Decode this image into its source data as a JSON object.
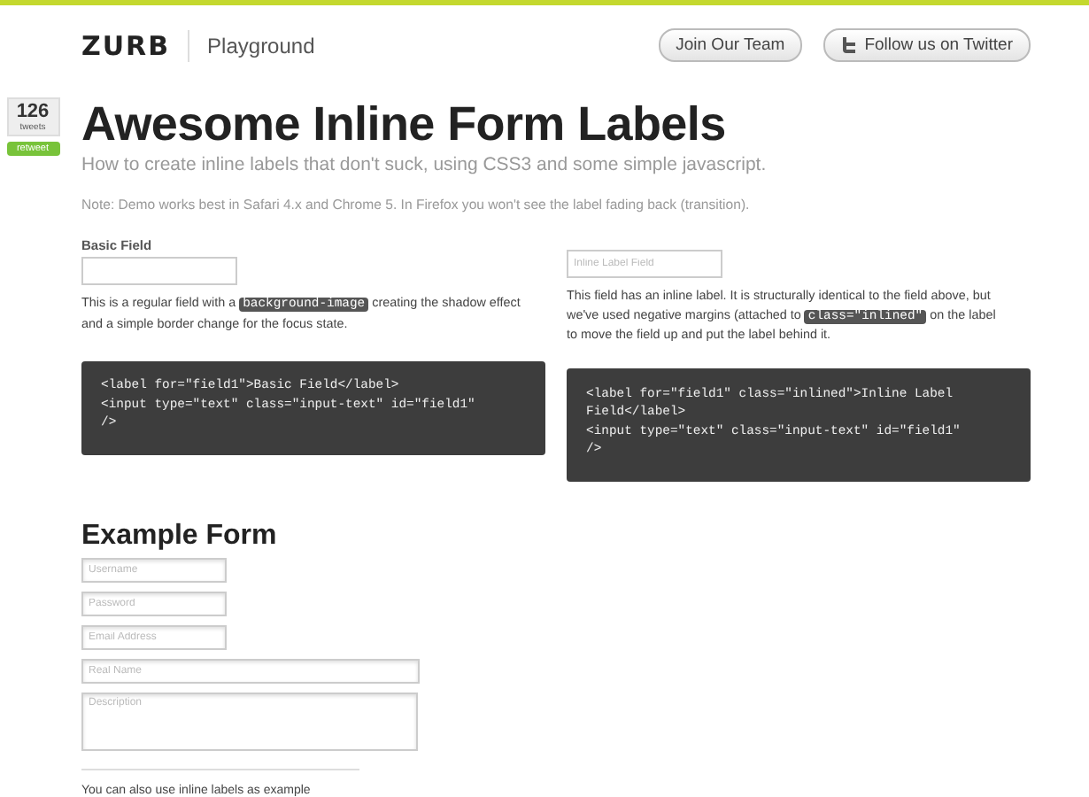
{
  "header": {
    "logo": "ZURB",
    "section": "Playground",
    "buttons": [
      {
        "label": "Join Our Team",
        "kind": "plain"
      },
      {
        "label": "Follow us on Twitter",
        "kind": "twitter"
      }
    ]
  },
  "tweet_badge": {
    "count": "126",
    "unit": "tweets",
    "action": "retweet"
  },
  "title": "Awesome Inline Form Labels",
  "subtitle": "How to create inline labels that don't suck, using CSS3 and some simple javascript.",
  "note": "Note: Demo works best in Safari 4.x and Chrome 5. In Firefox you won't see the label fading back (transition).",
  "demos": [
    {
      "label": "Basic Field",
      "description": [
        {
          "kind": "text",
          "text": "This is a regular field with a "
        },
        {
          "kind": "code",
          "text": "background-image"
        },
        {
          "kind": "text",
          "text": " creating the shadow effect and a simple border change for the focus state."
        }
      ],
      "code": [
        "<label for=\"field1\">Basic Field</label>",
        "<input type=\"text\" class=\"input-text\" id=\"field1\"",
        "/>"
      ]
    },
    {
      "placeholder": "Inline Label Field",
      "description": [
        {
          "kind": "text",
          "text": "This field has an inline label. It is structurally identical to the field above, but we've used negative margins (attached to "
        },
        {
          "kind": "code",
          "text": "class=\"inlined\""
        },
        {
          "kind": "text",
          "text": " on the label to move the field up and put the label behind it."
        }
      ],
      "code": [
        "<label for=\"field1\" class=\"inlined\">Inline Label",
        "Field</label>",
        "<input type=\"text\" class=\"input-text\" id=\"field1\"",
        "/>"
      ]
    }
  ],
  "example_form": {
    "heading": "Example Form",
    "fields": [
      {
        "kind": "short",
        "placeholder": "Username"
      },
      {
        "kind": "short",
        "placeholder": "Password"
      },
      {
        "kind": "short",
        "placeholder": "Email Address"
      },
      {
        "kind": "wide",
        "placeholder": "Real Name"
      },
      {
        "kind": "textarea",
        "placeholder": "Description"
      }
    ],
    "footer": "You can also use inline labels as example"
  }
}
